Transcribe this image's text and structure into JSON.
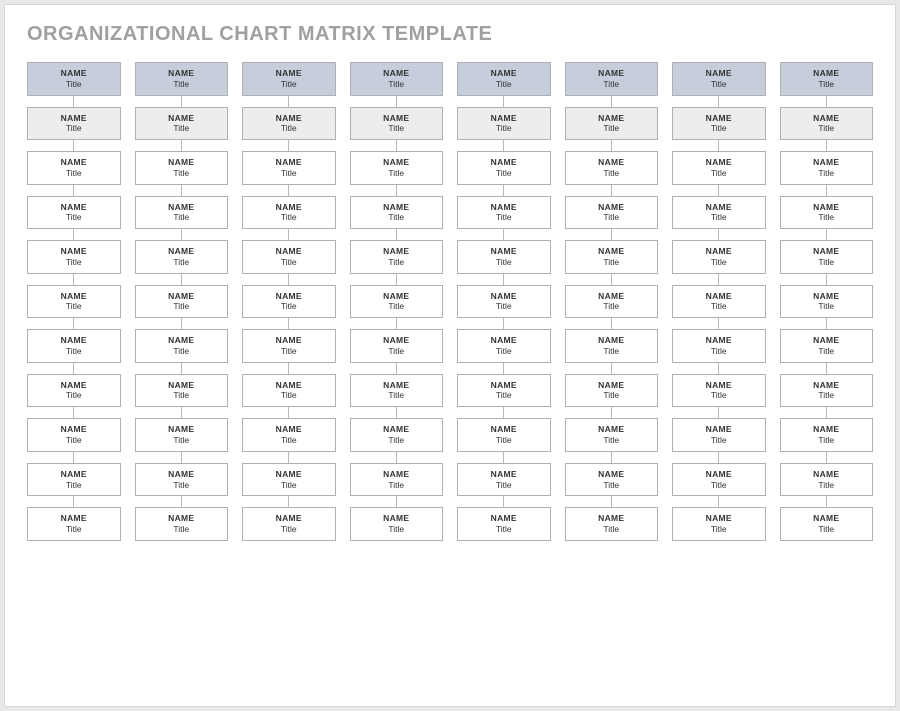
{
  "header": {
    "title": "ORGANIZATIONAL CHART MATRIX TEMPLATE"
  },
  "labels": {
    "name": "NAME",
    "title": "Title"
  },
  "matrix": {
    "columns": 8,
    "rows": 11
  },
  "colors": {
    "tier0": "#c6cedb",
    "tier1": "#ededed",
    "tierN": "#ffffff",
    "border": "#aeb0b4"
  }
}
